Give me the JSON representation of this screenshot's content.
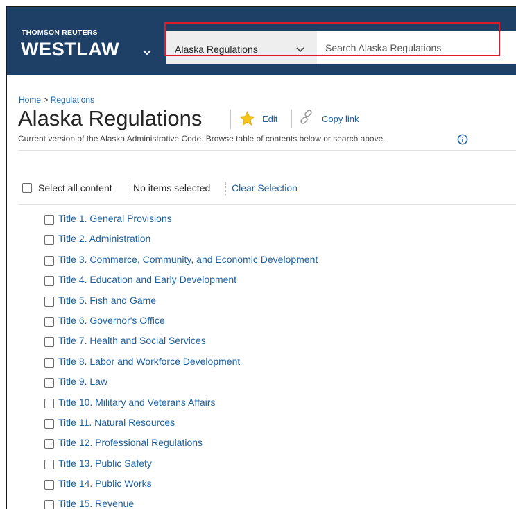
{
  "header": {
    "brand_top": "THOMSON REUTERS",
    "brand_main": "WESTLAW",
    "scope_select": "Alaska Regulations",
    "search_placeholder": "Search Alaska Regulations"
  },
  "breadcrumb": {
    "home": "Home",
    "separator": ">",
    "current": "Regulations"
  },
  "page": {
    "title": "Alaska Regulations",
    "edit_label": "Edit",
    "copy_link_label": "Copy link",
    "subtitle": "Current version of the Alaska Administrative Code. Browse table of contents below or search above."
  },
  "selection": {
    "select_all": "Select all content",
    "status": "No items selected",
    "clear": "Clear Selection"
  },
  "toc": [
    "Title 1. General Provisions",
    "Title 2. Administration",
    "Title 3. Commerce, Community, and Economic Development",
    "Title 4. Education and Early Development",
    "Title 5. Fish and Game",
    "Title 6. Governor's Office",
    "Title 7. Health and Social Services",
    "Title 8. Labor and Workforce Development",
    "Title 9. Law",
    "Title 10. Military and Veterans Affairs",
    "Title 11. Natural Resources",
    "Title 12. Professional Regulations",
    "Title 13. Public Safety",
    "Title 14. Public Works",
    "Title 15. Revenue"
  ],
  "colors": {
    "header_bg": "#1e3f66",
    "link": "#1d5f9e",
    "highlight": "#e0192a",
    "star": "#f5c518"
  },
  "icons": [
    "chevron-down-icon",
    "star-icon",
    "link-icon",
    "info-icon"
  ]
}
